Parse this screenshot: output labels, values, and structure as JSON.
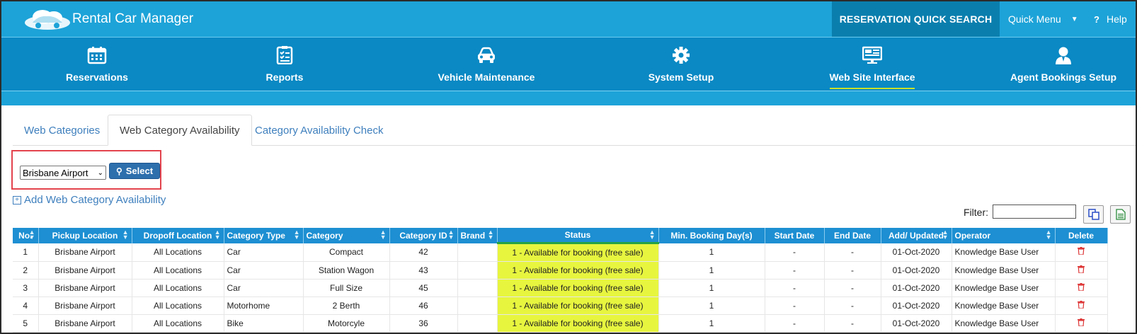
{
  "app": {
    "title": "Rental Car Manager"
  },
  "topbar": {
    "quick_search": "RESERVATION QUICK SEARCH",
    "quick_menu": "Quick Menu",
    "help": "Help"
  },
  "nav": {
    "items": [
      {
        "label": "Reservations",
        "icon": "calendar-icon"
      },
      {
        "label": "Reports",
        "icon": "checklist-icon"
      },
      {
        "label": "Vehicle Maintenance",
        "icon": "car-icon"
      },
      {
        "label": "System Setup",
        "icon": "gear-icon"
      },
      {
        "label": "Web Site Interface",
        "icon": "monitor-icon",
        "active": true
      },
      {
        "label": "Agent Bookings Setup",
        "icon": "user-icon"
      }
    ]
  },
  "tabs": [
    {
      "label": "Web Categories"
    },
    {
      "label": "Web Category Availability",
      "active": true
    },
    {
      "label": "Category Availability Check"
    }
  ],
  "location": {
    "selected": "Brisbane Airport",
    "select_label": "Select"
  },
  "add_link": "Add Web Category Availability",
  "filter": {
    "label": "Filter:",
    "value": ""
  },
  "table": {
    "headers": [
      "No.",
      "Pickup Location",
      "Dropoff Location",
      "Category Type",
      "Category",
      "Category ID",
      "Brand",
      "Status",
      "Min. Booking Day(s)",
      "Start Date",
      "End Date",
      "Add/ Updated",
      "Operator",
      "Delete"
    ],
    "rows": [
      {
        "no": "1",
        "pickup": "Brisbane Airport",
        "dropoff": "All Locations",
        "type": "Car",
        "category": "Compact",
        "id": "42",
        "brand": "",
        "status": "1 - Available for booking (free sale)",
        "min_days": "1",
        "start": "-",
        "end": "-",
        "updated": "01-Oct-2020",
        "operator": "Knowledge Base User"
      },
      {
        "no": "2",
        "pickup": "Brisbane Airport",
        "dropoff": "All Locations",
        "type": "Car",
        "category": "Station Wagon",
        "id": "43",
        "brand": "",
        "status": "1 - Available for booking (free sale)",
        "min_days": "1",
        "start": "-",
        "end": "-",
        "updated": "01-Oct-2020",
        "operator": "Knowledge Base User"
      },
      {
        "no": "3",
        "pickup": "Brisbane Airport",
        "dropoff": "All Locations",
        "type": "Car",
        "category": "Full Size",
        "id": "45",
        "brand": "",
        "status": "1 - Available for booking (free sale)",
        "min_days": "1",
        "start": "-",
        "end": "-",
        "updated": "01-Oct-2020",
        "operator": "Knowledge Base User"
      },
      {
        "no": "4",
        "pickup": "Brisbane Airport",
        "dropoff": "All Locations",
        "type": "Motorhome",
        "category": "2 Berth",
        "id": "46",
        "brand": "",
        "status": "1 - Available for booking (free sale)",
        "min_days": "1",
        "start": "-",
        "end": "-",
        "updated": "01-Oct-2020",
        "operator": "Knowledge Base User"
      },
      {
        "no": "5",
        "pickup": "Brisbane Airport",
        "dropoff": "All Locations",
        "type": "Bike",
        "category": "Motorcyle",
        "id": "36",
        "brand": "",
        "status": "1 - Available for booking (free sale)",
        "min_days": "1",
        "start": "-",
        "end": "-",
        "updated": "01-Oct-2020",
        "operator": "Knowledge Base User"
      }
    ]
  },
  "colors": {
    "topbar": "#1da3d8",
    "nav": "#0a89c4",
    "highlight": "#e7f53f",
    "link": "#3e7fbd",
    "danger": "#d33"
  }
}
